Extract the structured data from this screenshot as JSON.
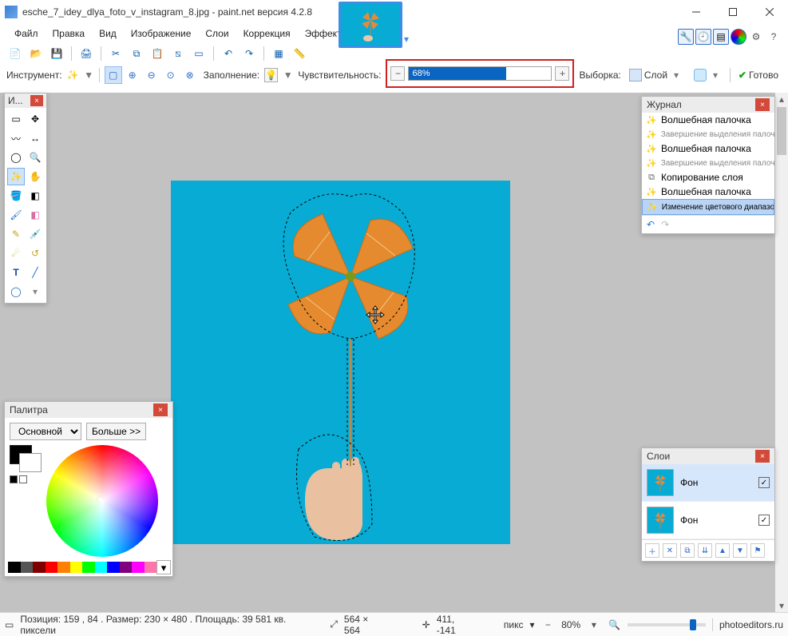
{
  "titlebar": {
    "filename": "esche_7_idey_dlya_foto_v_instagram_8.jpg",
    "app": "paint.net версия 4.2.8"
  },
  "menu": [
    "Файл",
    "Правка",
    "Вид",
    "Изображение",
    "Слои",
    "Коррекция",
    "Эффекты"
  ],
  "optbar": {
    "instrument": "Инструмент:",
    "fill": "Заполнение:",
    "tolerance": "Чувствительность:",
    "tolerance_value": "68%",
    "selection": "Выборка:",
    "layer": "Слой",
    "finish": "Готово"
  },
  "tools_panel": {
    "title": "И..."
  },
  "palette": {
    "title": "Палитра",
    "mode": "Основной",
    "more": "Больше >>"
  },
  "history": {
    "title": "Журнал",
    "items": [
      "Волшебная палочка",
      "Завершение выделения палочкой",
      "Волшебная палочка",
      "Завершение выделения палочкой",
      "Копирование слоя",
      "Волшебная палочка",
      "Изменение цветового диапазона"
    ],
    "selected_index": 6
  },
  "layers": {
    "title": "Слои",
    "items": [
      {
        "name": "Фон",
        "visible": true,
        "active": true
      },
      {
        "name": "Фон",
        "visible": true,
        "active": false
      }
    ]
  },
  "status": {
    "pos": "Позиция: 159 , 84 . Размер: 230   × 480 . Площадь: 39 581 кв. пиксели",
    "canvas_size": "564 × 564",
    "cursor": "411, -141",
    "unit": "пикс",
    "zoom": "80%",
    "site": "photoeditors.ru"
  }
}
